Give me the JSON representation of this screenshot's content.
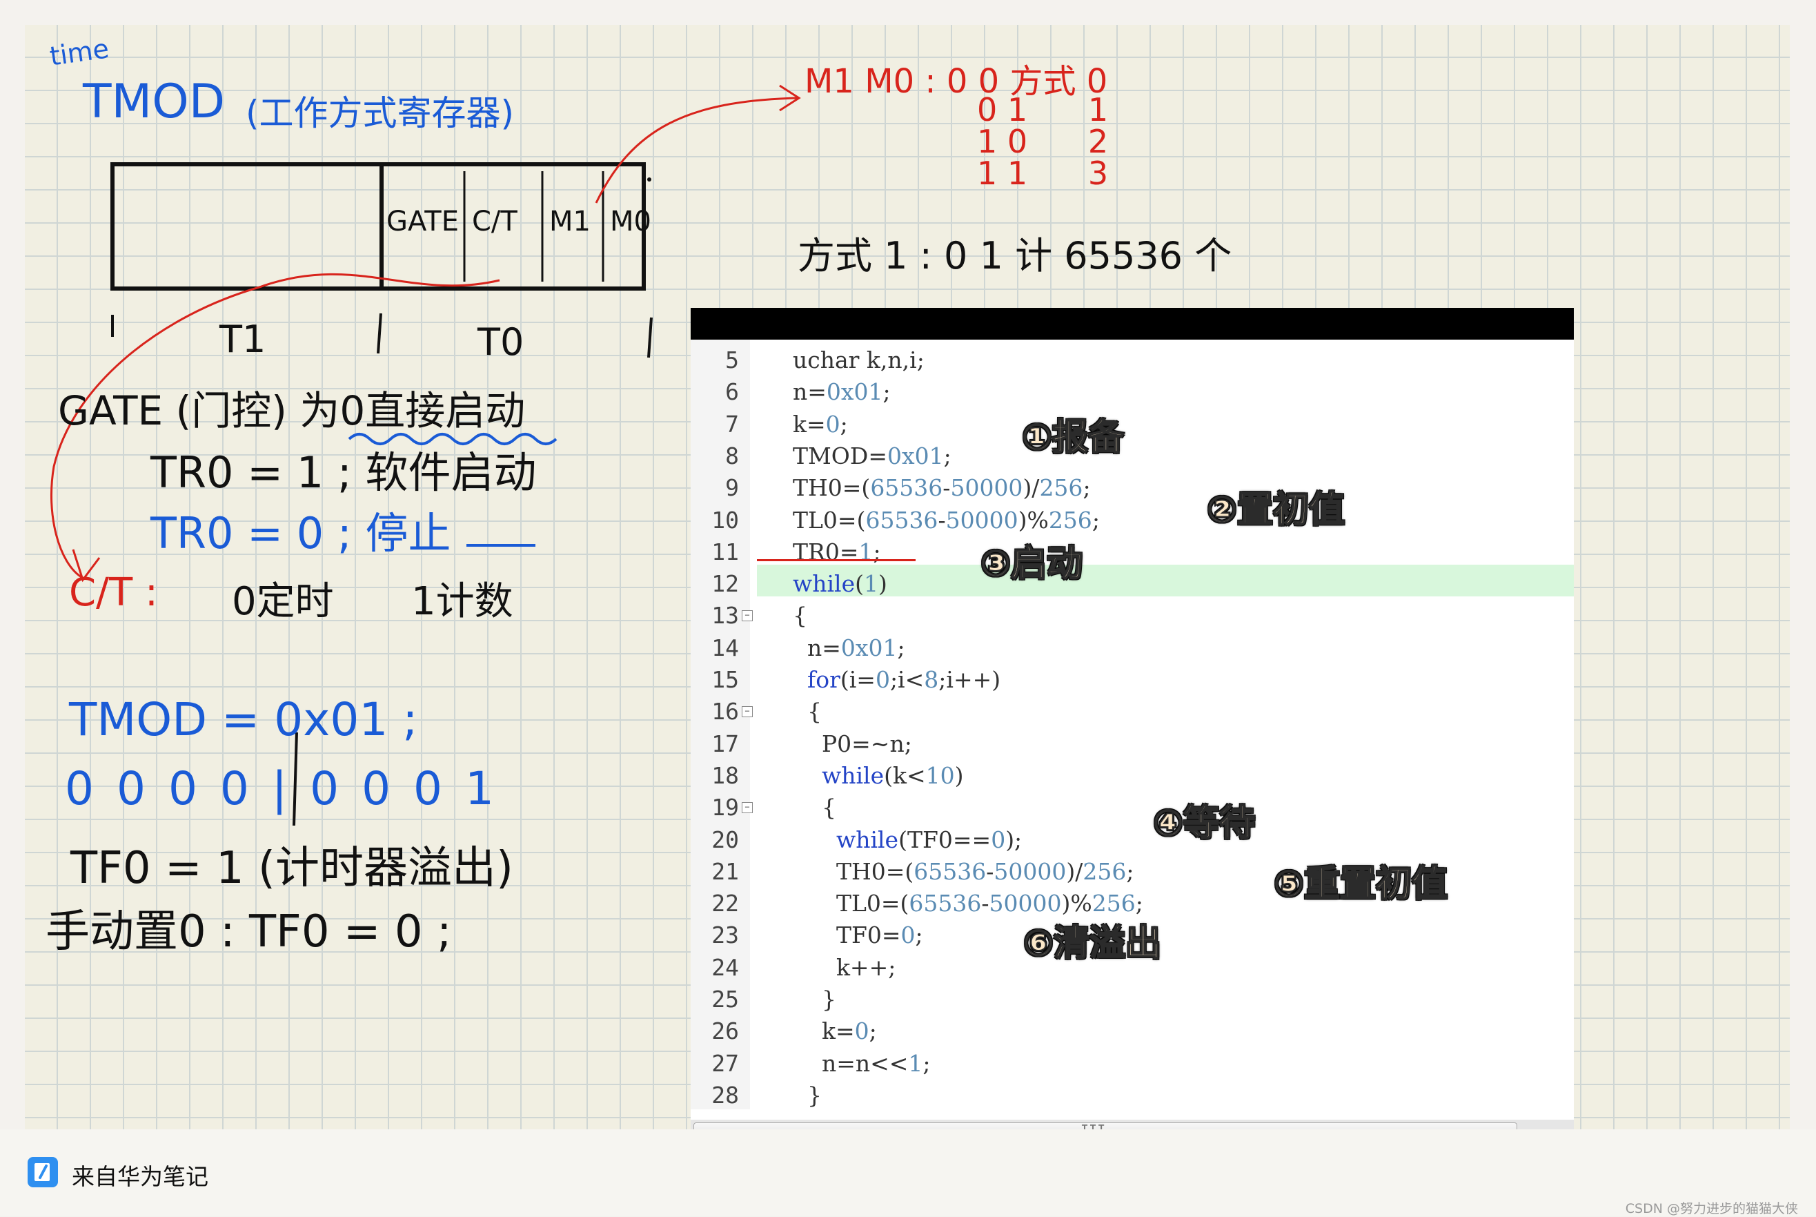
{
  "notes": {
    "time_label": "time",
    "tmod_title": "TMOD",
    "tmod_title_note": "(工作方式寄存器)",
    "register_cells": [
      "GATE",
      "C/T",
      "M1",
      "M0"
    ],
    "timer_labels": [
      "T1",
      "T0"
    ],
    "gate_line": "GATE (门控) 为0直接启动",
    "tr0_start": "TR0 = 1 ;  软件启动",
    "tr0_stop": "TR0 = 0 ;  停止",
    "ct_label": "C/T :",
    "ct_timing": "0定时",
    "ct_counting": "1计数",
    "tmod_value": "TMOD = 0x01 ;",
    "tmod_bits": "0 0 0 0 | 0 0 0 1",
    "tf0_overflow": "TF0 = 1 (计时器溢出)",
    "tf0_reset": "手动置0 :   TF0 = 0 ;",
    "mode_header": "M1  M0  :  0 0   方式 0",
    "mode_rows": [
      "0 1      1",
      "1 0      2",
      "1 1      3"
    ],
    "mode1_line": "方式 1  :  0 1     计 65536 个"
  },
  "code": {
    "lines": [
      {
        "n": "5",
        "text": "uchar k,n,i;"
      },
      {
        "n": "6",
        "text": "n=0x01;"
      },
      {
        "n": "7",
        "text": "k=0;"
      },
      {
        "n": "8",
        "text": "TMOD=0x01;"
      },
      {
        "n": "9",
        "text": "TH0=(65536-50000)/256;"
      },
      {
        "n": "10",
        "text": "TL0=(65536-50000)%256;"
      },
      {
        "n": "11",
        "text": "TR0=1;"
      },
      {
        "n": "12",
        "text": "while(1)"
      },
      {
        "n": "13",
        "text": "{"
      },
      {
        "n": "14",
        "text": "  n=0x01;"
      },
      {
        "n": "15",
        "text": "  for(i=0;i<8;i++)"
      },
      {
        "n": "16",
        "text": "  {"
      },
      {
        "n": "17",
        "text": "    P0=~n;"
      },
      {
        "n": "18",
        "text": "    while(k<10)"
      },
      {
        "n": "19",
        "text": "    {"
      },
      {
        "n": "20",
        "text": "      while(TF0==0);"
      },
      {
        "n": "21",
        "text": "      TH0=(65536-50000)/256;"
      },
      {
        "n": "22",
        "text": "      TL0=(65536-50000)%256;"
      },
      {
        "n": "23",
        "text": "      TF0=0;"
      },
      {
        "n": "24",
        "text": "      k++;"
      },
      {
        "n": "25",
        "text": "    }"
      },
      {
        "n": "26",
        "text": "    k=0;"
      },
      {
        "n": "27",
        "text": "    n=n<<1;"
      },
      {
        "n": "28",
        "text": "  }"
      }
    ],
    "annotations": [
      "①报备",
      "②置初值",
      "③启动",
      "④等待",
      "⑤重置初值",
      "⑥清溢出"
    ]
  },
  "footer": {
    "source_label": "来自华为笔记",
    "watermark": "CSDN @努力进步的猫猫大侠"
  },
  "colors": {
    "pen_blue": "#1a5bd6",
    "pen_black": "#111111",
    "pen_red": "#d8241c",
    "paper": "#f1efe2",
    "highlight": "#d8f7dc"
  }
}
